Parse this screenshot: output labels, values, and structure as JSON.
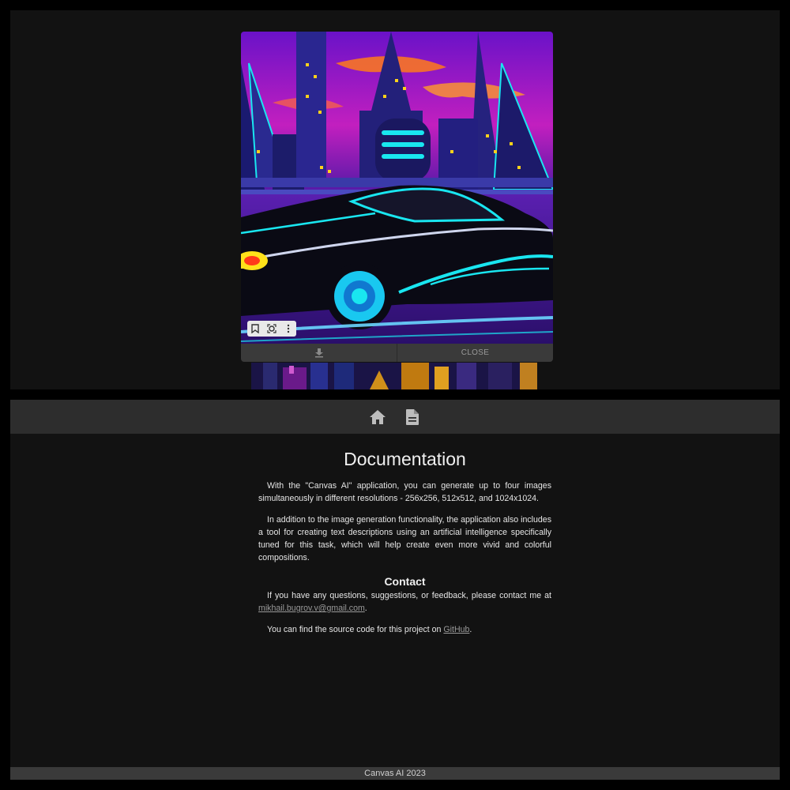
{
  "viewer": {
    "image_alt": "neon car in synthwave city",
    "toolbar_icons": [
      "bookmark-icon",
      "lens-icon",
      "more-vert-icon"
    ],
    "download_icon": "download-icon",
    "close_label": "CLOSE"
  },
  "navbar": {
    "icons": [
      "home-icon",
      "document-icon"
    ]
  },
  "doc": {
    "title": "Documentation",
    "paragraph1": "With the \"Canvas AI\" application, you can generate up to four images simultaneously in different resolutions - 256x256, 512x512, and 1024x1024.",
    "paragraph2": "In addition to the image generation functionality, the application also includes a tool for creating text descriptions using an artificial intelligence specifically tuned for this task, which will help create even more vivid and colorful compositions.",
    "contact_heading": "Contact",
    "contact_text": "If you have any questions, suggestions, or feedback, please contact me at",
    "contact_email": "mikhail.bugrov.v@gmail.com",
    "contact_end": ".",
    "source_text": "You can find the source code for this project on",
    "source_link": "GitHub",
    "source_end": "."
  },
  "footer": {
    "text": "Canvas AI 2023"
  },
  "colors": {
    "background": "#121212",
    "navbar": "#2d2d2d",
    "footer": "#3a3a3a",
    "neon_cyan": "#19e6f0",
    "sky_purple": "#8a1ad6"
  }
}
